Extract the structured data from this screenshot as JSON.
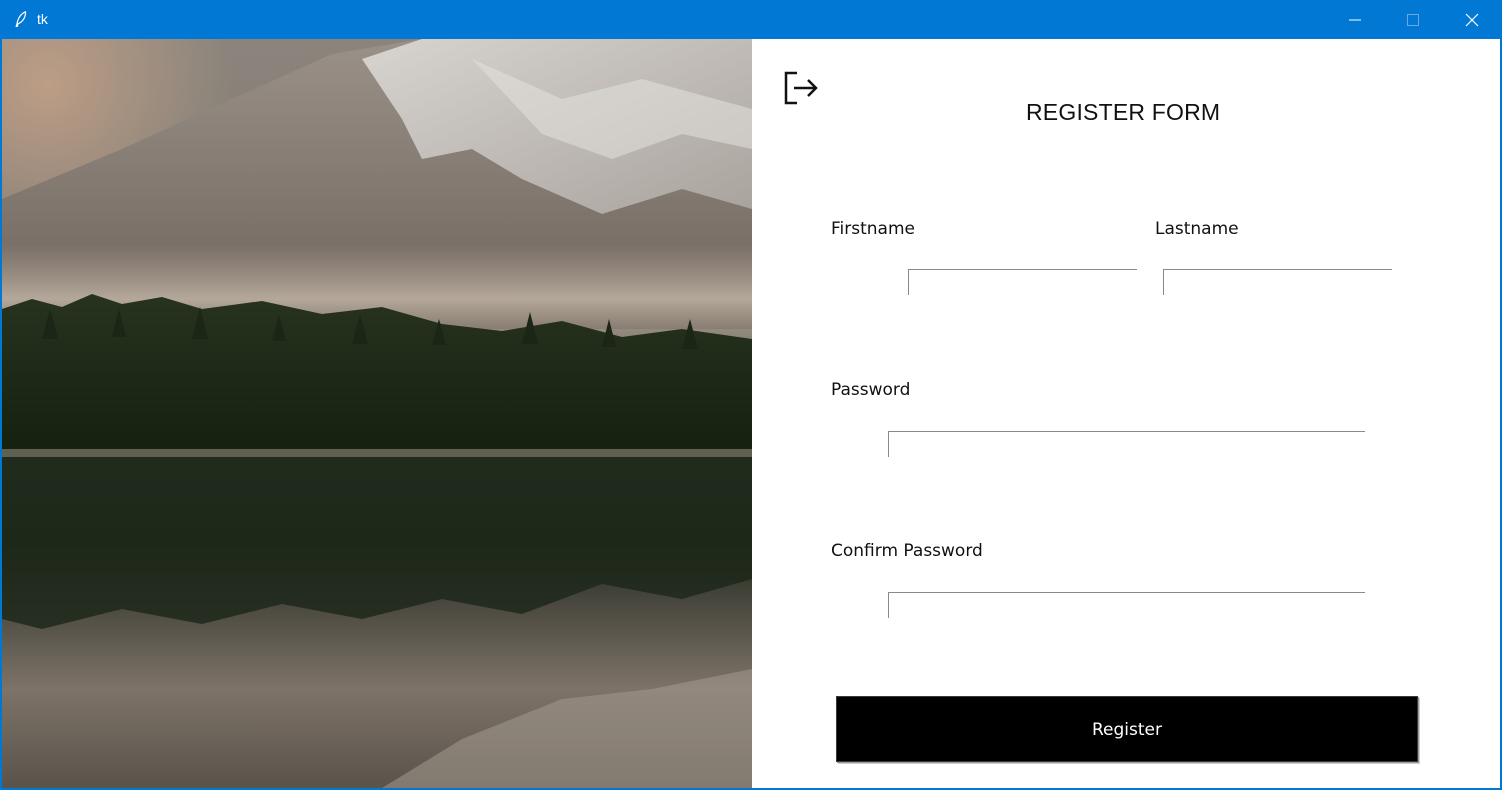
{
  "window": {
    "title": "tk",
    "controls": {
      "minimize": "minimize-icon",
      "maximize": "maximize-icon",
      "close": "close-icon"
    },
    "titlebar_color": "#0078d4"
  },
  "hero": {
    "subject": "mountain lake landscape photograph"
  },
  "form": {
    "title": "REGISTER FORM",
    "logout_icon": "logout-icon",
    "firstname_label": "Firstname",
    "firstname_value": "",
    "lastname_label": "Lastname",
    "lastname_value": "",
    "password_label": "Password",
    "password_value": "",
    "confirm_password_label": "Confirm Password",
    "confirm_password_value": "",
    "register_label": "Register",
    "button_color": "#000000"
  }
}
